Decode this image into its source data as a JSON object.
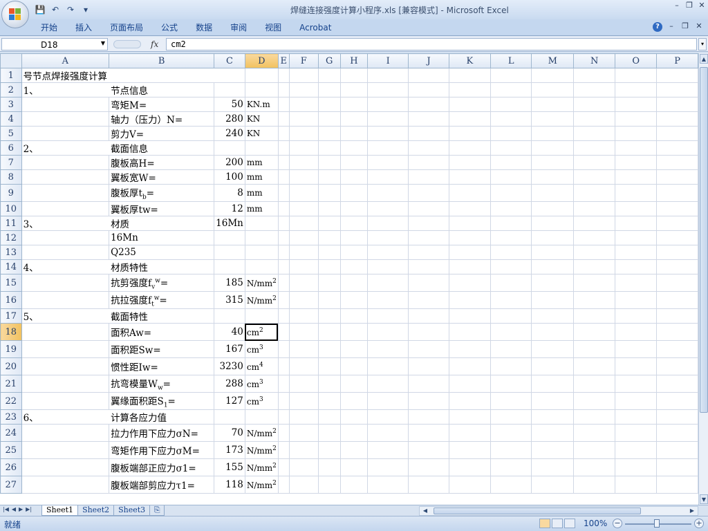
{
  "window": {
    "title": "焊缝连接强度计算小程序.xls  [兼容模式] - Microsoft Excel",
    "controls": [
      "–",
      "❐",
      "✕"
    ]
  },
  "ribbon": {
    "tabs": [
      "开始",
      "插入",
      "页面布局",
      "公式",
      "数据",
      "审阅",
      "视图",
      "Acrobat"
    ]
  },
  "formula_bar": {
    "name_box": "D18",
    "fx": "fx",
    "content": "cm2"
  },
  "columns": [
    "A",
    "B",
    "C",
    "D",
    "E",
    "F",
    "G",
    "H",
    "I",
    "J",
    "K",
    "L",
    "M",
    "N",
    "O",
    "P"
  ],
  "rows": [
    {
      "n": "1",
      "a": "号节点焊接强度计算",
      "b": "",
      "c": "",
      "d": "",
      "dsup": ""
    },
    {
      "n": "2",
      "a": "1、",
      "b": "节点信息",
      "c": "",
      "d": "",
      "dsup": ""
    },
    {
      "n": "3",
      "a": "",
      "b": "弯矩M=",
      "c": "50",
      "d": "KN.m",
      "dsup": ""
    },
    {
      "n": "4",
      "a": "",
      "b": "轴力（压力）N=",
      "c": "280",
      "d": "KN",
      "dsup": ""
    },
    {
      "n": "5",
      "a": "",
      "b": "剪力V=",
      "c": "240",
      "d": "KN",
      "dsup": ""
    },
    {
      "n": "6",
      "a": "2、",
      "b": "截面信息",
      "c": "",
      "d": "",
      "dsup": ""
    },
    {
      "n": "7",
      "a": "",
      "b": "腹板高H=",
      "c": "200",
      "d": "mm",
      "dsup": ""
    },
    {
      "n": "8",
      "a": "",
      "b": "翼板宽W=",
      "c": "100",
      "d": "mm",
      "dsup": ""
    },
    {
      "n": "9",
      "a": "",
      "b": "腹板厚tb=",
      "c": "8",
      "d": "mm",
      "dsup": ""
    },
    {
      "n": "10",
      "a": "",
      "b": "翼板厚tw=",
      "c": "12",
      "d": "mm",
      "dsup": ""
    },
    {
      "n": "11",
      "a": "3、",
      "b": "材质",
      "c": "16Mn",
      "d": "",
      "dsup": ""
    },
    {
      "n": "12",
      "a": "",
      "b": "16Mn",
      "c": "",
      "d": "",
      "dsup": ""
    },
    {
      "n": "13",
      "a": "",
      "b": "Q235",
      "c": "",
      "d": "",
      "dsup": ""
    },
    {
      "n": "14",
      "a": "4、",
      "b": "材质特性",
      "c": "",
      "d": "",
      "dsup": ""
    },
    {
      "n": "15",
      "a": "",
      "b": "抗剪强度fvw=",
      "c": "185",
      "d": "N/mm",
      "dsup": "2"
    },
    {
      "n": "16",
      "a": "",
      "b": "抗拉强度ftw=",
      "c": "315",
      "d": "N/mm",
      "dsup": "2"
    },
    {
      "n": "17",
      "a": "5、",
      "b": "截面特性",
      "c": "",
      "d": "",
      "dsup": ""
    },
    {
      "n": "18",
      "a": "",
      "b": "面积Aw=",
      "c": "40",
      "d": "cm",
      "dsup": "2"
    },
    {
      "n": "19",
      "a": "",
      "b": "面积距Sw=",
      "c": "167",
      "d": "cm",
      "dsup": "3"
    },
    {
      "n": "20",
      "a": "",
      "b": "惯性距Iw=",
      "c": "3230",
      "d": "cm",
      "dsup": "4"
    },
    {
      "n": "21",
      "a": "",
      "b": "抗弯模量Ww=",
      "c": "288",
      "d": "cm",
      "dsup": "3"
    },
    {
      "n": "22",
      "a": "",
      "b": "翼缘面积距S1=",
      "c": "127",
      "d": "cm",
      "dsup": "3"
    },
    {
      "n": "23",
      "a": "6、",
      "b": "计算各应力值",
      "c": "",
      "d": "",
      "dsup": ""
    },
    {
      "n": "24",
      "a": "",
      "b": "拉力作用下应力σN=",
      "c": "70",
      "d": "N/mm",
      "dsup": "2"
    },
    {
      "n": "25",
      "a": "",
      "b": "弯矩作用下应力σM=",
      "c": "173",
      "d": "N/mm",
      "dsup": "2"
    },
    {
      "n": "26",
      "a": "",
      "b": "腹板端部正应力σ1=",
      "c": "155",
      "d": "N/mm",
      "dsup": "2"
    },
    {
      "n": "27",
      "a": "",
      "b": "腹板端部剪应力τ1=",
      "c": "118",
      "d": "N/mm",
      "dsup": "2"
    }
  ],
  "sheet_tabs": [
    "Sheet1",
    "Sheet2",
    "Sheet3"
  ],
  "active_sheet": "Sheet1",
  "status": {
    "text": "就绪",
    "zoom": "100%"
  },
  "colors": {
    "accent": "#15428b",
    "selected_header": "#f1c15f",
    "grid_line": "#d0d7e5"
  }
}
